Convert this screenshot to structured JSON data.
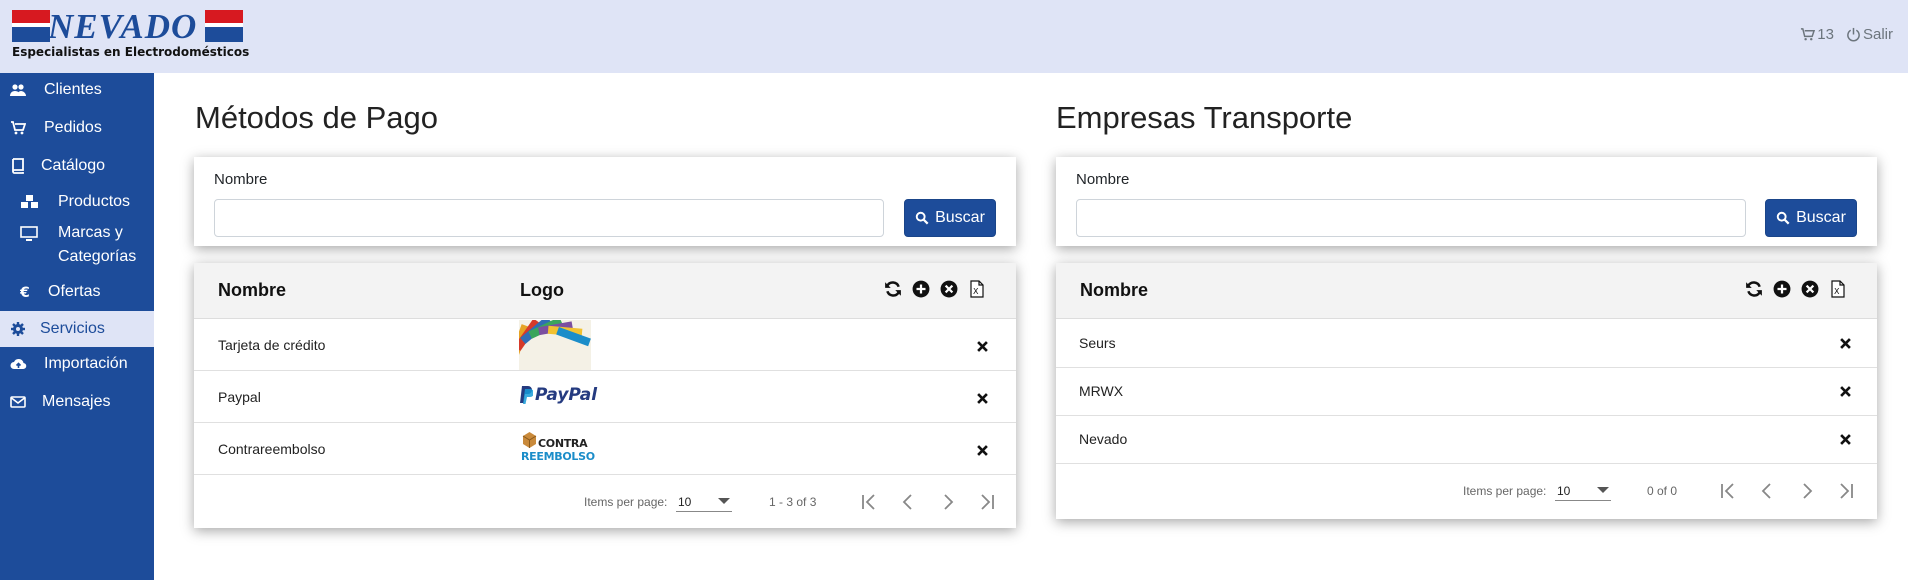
{
  "header": {
    "brand": "NEVADO",
    "tagline": "Especialistas en Electrodomésticos",
    "cart_count": "13",
    "logout_label": "Salir"
  },
  "sidebar": {
    "items": [
      {
        "label": "Clientes",
        "icon": "users-icon"
      },
      {
        "label": "Pedidos",
        "icon": "cart-icon"
      },
      {
        "label": "Catálogo",
        "icon": "book-icon"
      },
      {
        "label": "Productos",
        "icon": "cubes-icon"
      },
      {
        "label": "Marcas y",
        "label2": "Categorías",
        "icon": "monitor-icon"
      },
      {
        "label": "Ofertas",
        "icon": "euro-icon"
      },
      {
        "label": "Servicios",
        "icon": "gear-icon",
        "active": true
      },
      {
        "label": "Importación",
        "icon": "cloud-upload-icon"
      },
      {
        "label": "Mensajes",
        "icon": "envelope-icon"
      }
    ]
  },
  "payment": {
    "title": "Métodos de Pago",
    "filter_label": "Nombre",
    "search_value": "",
    "search_button": "Buscar",
    "col_name": "Nombre",
    "col_logo": "Logo",
    "rows": [
      {
        "name": "Tarjeta de crédito",
        "logo": "credit-cards-logo"
      },
      {
        "name": "Paypal",
        "logo": "paypal-logo",
        "logo_text": "PayPal"
      },
      {
        "name": "Contrareembolso",
        "logo": "contrareembolso-logo",
        "logo_text1": "CONTRA",
        "logo_text2": "REEMBOLSO"
      }
    ],
    "items_per_page_label": "Items per page:",
    "items_per_page": "10",
    "range": "1 - 3 of 3"
  },
  "transport": {
    "title": "Empresas Transporte",
    "filter_label": "Nombre",
    "search_value": "",
    "search_button": "Buscar",
    "col_name": "Nombre",
    "rows": [
      {
        "name": "Seurs"
      },
      {
        "name": "MRWX"
      },
      {
        "name": "Nevado"
      }
    ],
    "items_per_page_label": "Items per page:",
    "items_per_page": "10",
    "range": "0 of 0"
  },
  "colors": {
    "brand_blue": "#1d4c9a",
    "header_bg": "#dfe4f6",
    "flag_red": "#d71920"
  }
}
